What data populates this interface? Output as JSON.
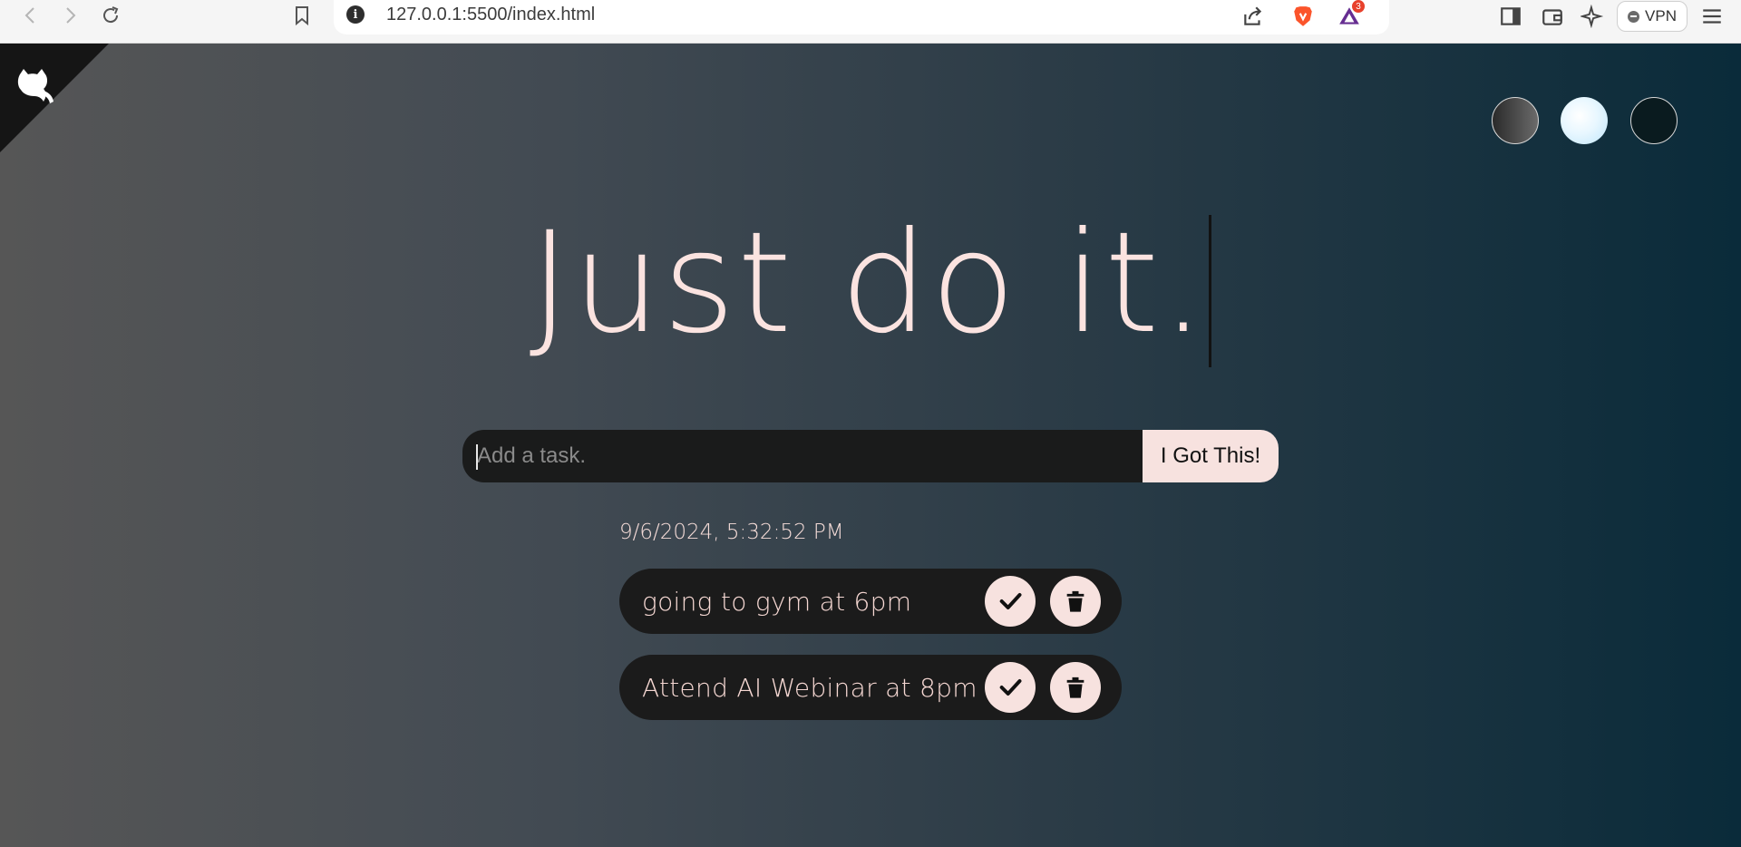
{
  "browser": {
    "url": "127.0.0.1:5500/index.html",
    "info_symbol": "i",
    "alert_badge_count": "3",
    "vpn_label": "VPN"
  },
  "page": {
    "title": "Just do it.",
    "input_placeholder": "Add a task.",
    "input_value": "",
    "submit_label": "I Got This!",
    "timestamp": "9/6/2024, 5:32:52 PM",
    "themes": [
      {
        "name": "standard",
        "color": "#565656"
      },
      {
        "name": "light",
        "color": "#e8f7ff"
      },
      {
        "name": "darker",
        "color": "#0a1b1f"
      }
    ],
    "todos": [
      {
        "text": "going to gym at 6pm"
      },
      {
        "text": "Attend AI Webinar at 8pm"
      }
    ]
  },
  "colors": {
    "accent_pink": "#f7e2df",
    "title_text": "#fbe3e0",
    "item_bg": "#1b1b1b"
  },
  "icons": {
    "corner": "github-icon",
    "complete": "check-icon",
    "delete": "trash-icon"
  }
}
